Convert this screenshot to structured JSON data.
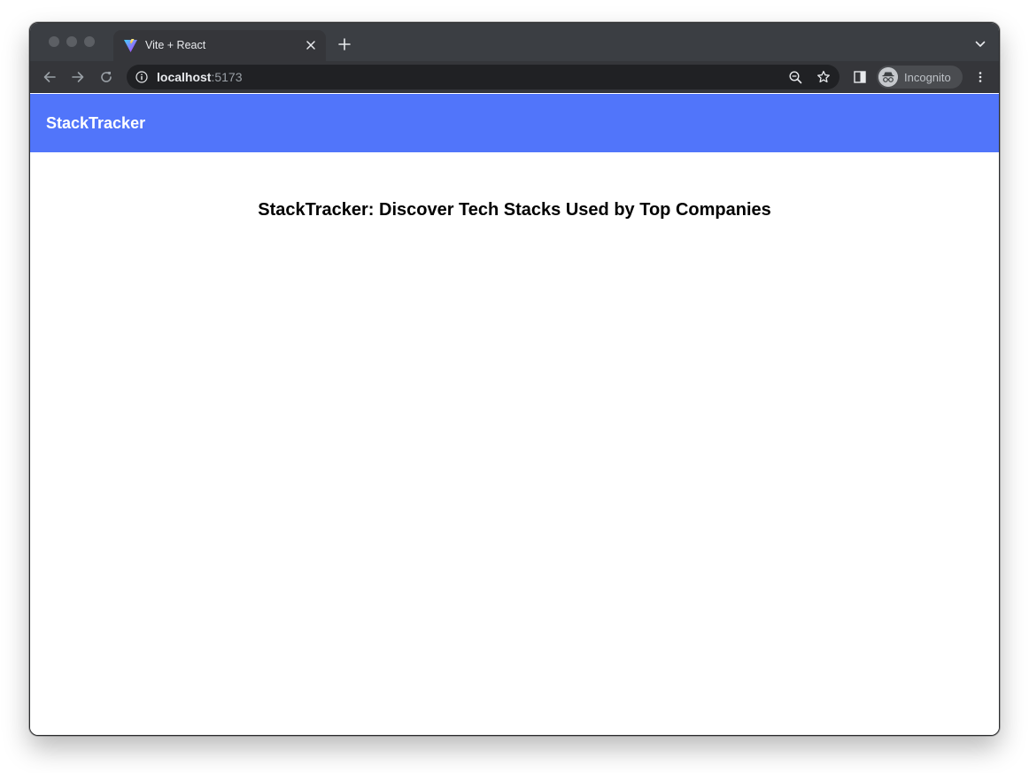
{
  "browser": {
    "tab": {
      "title": "Vite + React",
      "favicon": "vite-logo-icon"
    },
    "address": {
      "host": "localhost",
      "port": ":5173"
    },
    "profile": {
      "label": "Incognito",
      "icon": "incognito-icon"
    },
    "icons": {
      "back": "arrow-left-icon",
      "forward": "arrow-right-icon",
      "reload": "reload-icon",
      "info": "info-icon",
      "zoom": "zoom-out-icon",
      "bookmark": "star-icon",
      "side_panel": "side-panel-icon",
      "menu": "kebab-menu-icon",
      "close_tab": "close-icon",
      "new_tab": "plus-icon",
      "tab_search": "chevron-down-icon"
    },
    "colors": {
      "tabstrip": "#3b3e43",
      "toolbar": "#35363a",
      "omnibox": "#202124"
    }
  },
  "app": {
    "navbar": {
      "brand": "StackTracker",
      "color": "#5175fa"
    },
    "main": {
      "title": "StackTracker: Discover Tech Stacks Used by Top Companies"
    }
  }
}
